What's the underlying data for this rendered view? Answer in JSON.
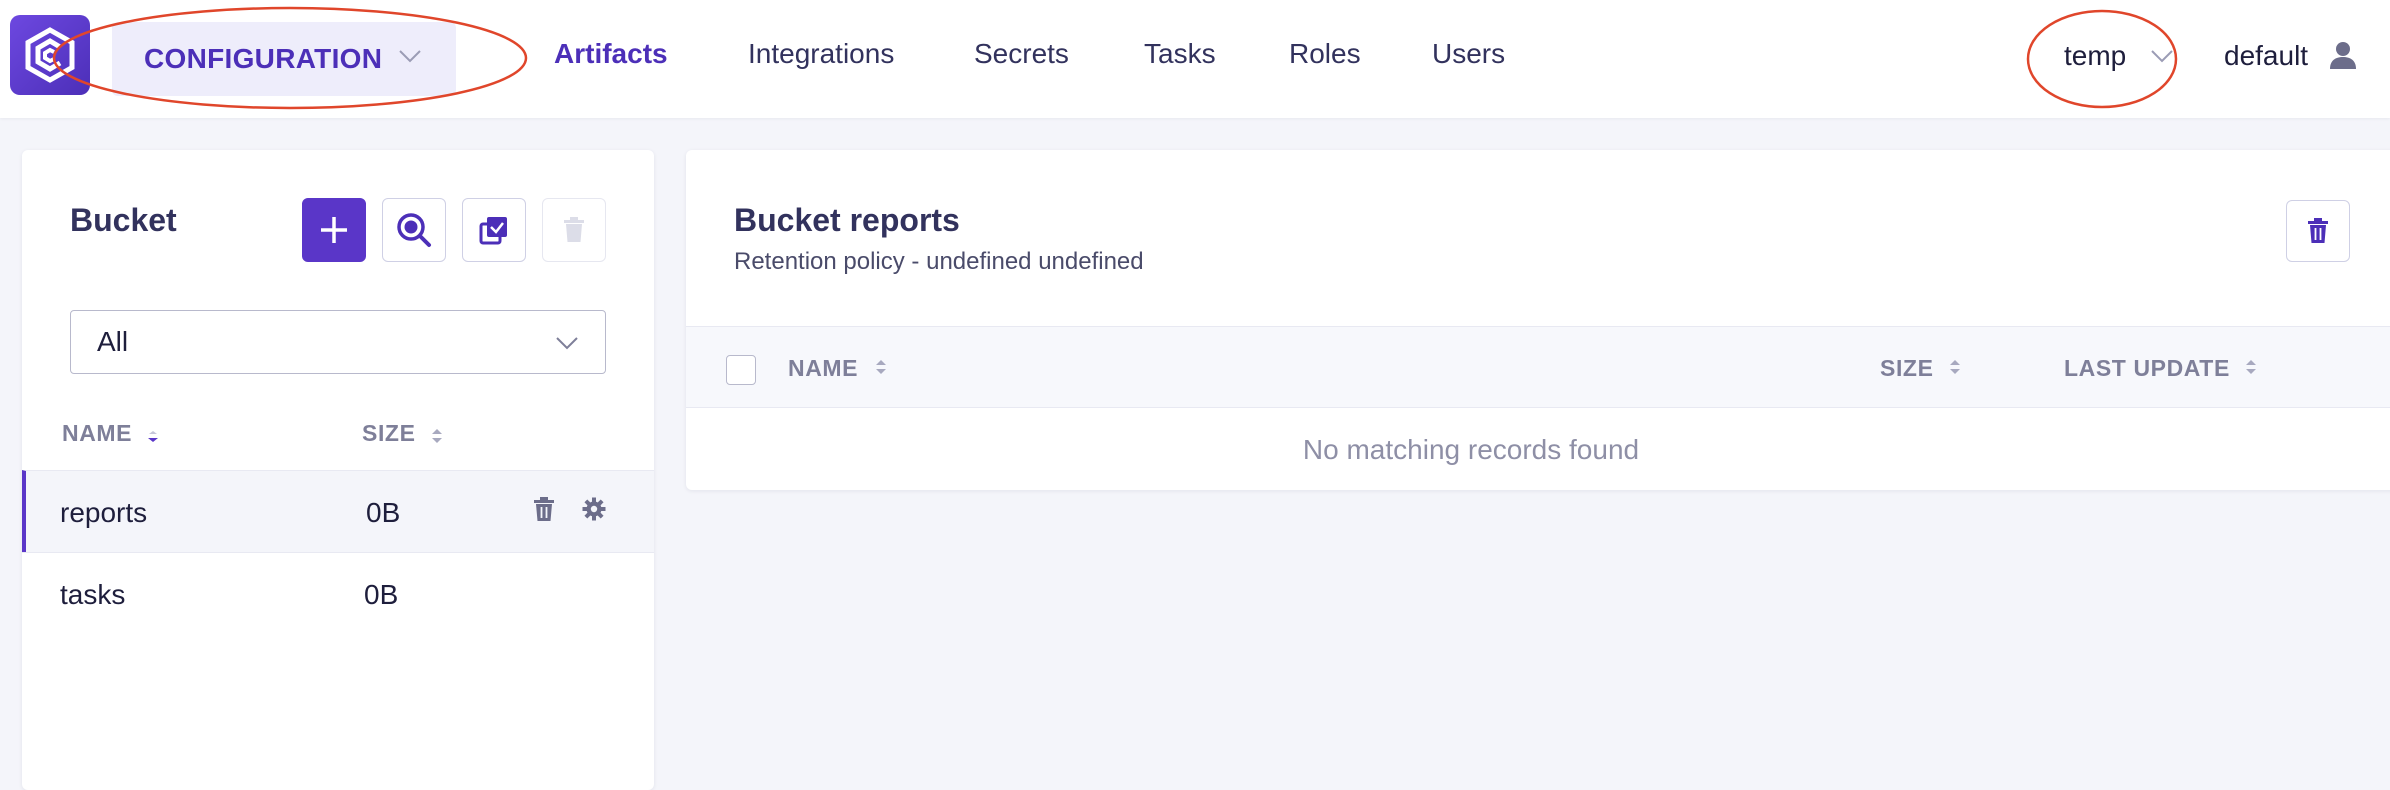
{
  "header": {
    "section_dropdown": "CONFIGURATION",
    "nav": [
      {
        "label": "Artifacts",
        "active": true
      },
      {
        "label": "Integrations",
        "active": false
      },
      {
        "label": "Secrets",
        "active": false
      },
      {
        "label": "Tasks",
        "active": false
      },
      {
        "label": "Roles",
        "active": false
      },
      {
        "label": "Users",
        "active": false
      }
    ],
    "tenant": "temp",
    "user": "default"
  },
  "left_panel": {
    "title": "Bucket",
    "filter_value": "All",
    "columns": {
      "name": "NAME",
      "size": "SIZE"
    },
    "rows": [
      {
        "name": "reports",
        "size": "0B",
        "selected": true
      },
      {
        "name": "tasks",
        "size": "0B",
        "selected": false
      }
    ]
  },
  "right_panel": {
    "title": "Bucket reports",
    "subtitle": "Retention policy - undefined undefined",
    "columns": {
      "name": "NAME",
      "size": "SIZE",
      "last_update": "LAST UPDATE"
    },
    "empty_message": "No matching records found"
  },
  "colors": {
    "accent": "#5a36c8",
    "accent_text": "#4c2fb8",
    "annotation": "#e0462b",
    "background": "#f4f5fa"
  },
  "icons": [
    "logo-icon",
    "chevron-down-icon",
    "user-icon",
    "plus-icon",
    "search-icon",
    "copy-icon",
    "trash-icon",
    "gear-icon",
    "sort-icon"
  ]
}
